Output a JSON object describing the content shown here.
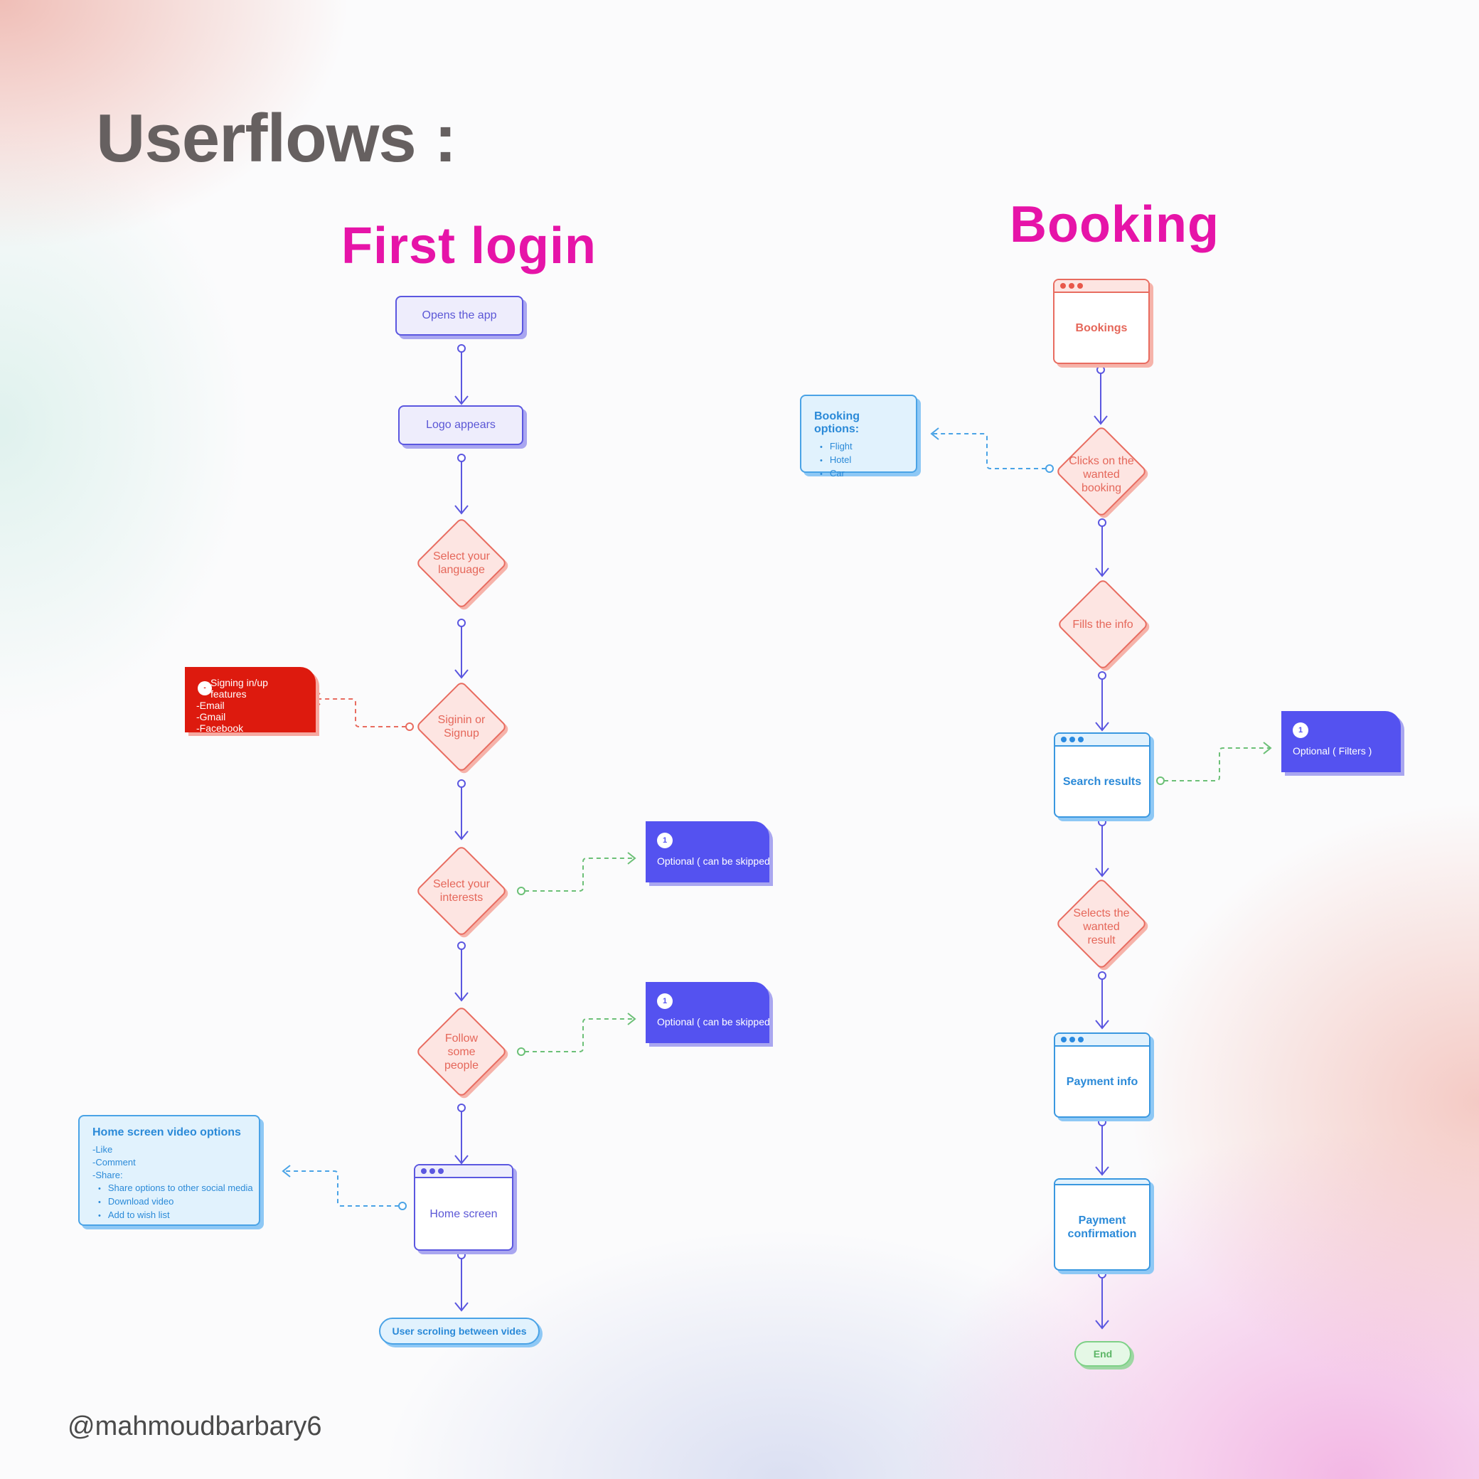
{
  "page": {
    "title": "Userflows :",
    "handle": "@mahmoudbarbary6"
  },
  "first_login": {
    "title": "First login",
    "steps": [
      {
        "id": "opens-app",
        "type": "process",
        "label": "Opens the app"
      },
      {
        "id": "logo-appears",
        "type": "process",
        "label": "Logo appears"
      },
      {
        "id": "select-language",
        "type": "decision",
        "label": "Select your language"
      },
      {
        "id": "signin-signup",
        "type": "decision",
        "label": "Siginin or Signup"
      },
      {
        "id": "select-interests",
        "type": "decision",
        "label": "Select your interests"
      },
      {
        "id": "follow-people",
        "type": "decision",
        "label": "Follow some people"
      },
      {
        "id": "home-screen",
        "type": "screen",
        "label": "Home screen"
      },
      {
        "id": "user-scrolling",
        "type": "terminal",
        "label": "User scroling between vides"
      }
    ],
    "notes": {
      "signin_callout": {
        "number": "-",
        "lines": [
          "Signing in/up",
          "features",
          "-Email",
          "-Gmail",
          "-Facebook"
        ]
      },
      "interests_callout": {
        "number": "1",
        "text": "Optional ( can be skipped"
      },
      "follow_callout": {
        "number": "1",
        "text": "Optional ( can be skipped"
      },
      "home_options": {
        "title": "Home screen video options",
        "items": [
          "-Like",
          "-Comment",
          "-Share:"
        ],
        "bullets": [
          "Share options to other social media",
          "Download video",
          "Add to wish list"
        ]
      }
    }
  },
  "booking": {
    "title": "Booking",
    "steps": [
      {
        "id": "bookings",
        "type": "screen",
        "label": "Bookings"
      },
      {
        "id": "clicks-booking",
        "type": "decision",
        "label": "Clicks on the wanted booking"
      },
      {
        "id": "fills-info",
        "type": "decision",
        "label": "Fills the info"
      },
      {
        "id": "search-results",
        "type": "screen",
        "label": "Search results"
      },
      {
        "id": "selects-result",
        "type": "decision",
        "label": "Selects the wanted result"
      },
      {
        "id": "payment-info",
        "type": "screen",
        "label": "Payment info"
      },
      {
        "id": "payment-confirmation",
        "type": "screen",
        "label": "Payment confirmation"
      },
      {
        "id": "end",
        "type": "terminal",
        "label": "End"
      }
    ],
    "notes": {
      "booking_options": {
        "title": "Booking options:",
        "bullets": [
          "Flight",
          "Hotel",
          "Car"
        ]
      },
      "filters_callout": {
        "number": "1",
        "text": "Optional ( Filters )"
      }
    }
  },
  "colors": {
    "title_gray": "#666060",
    "section_magenta": "#e614a8",
    "flow_purple": "#5b57e0",
    "decision_red": "#e86c60",
    "note_blue": "#4aa3e6",
    "optional_green": "#6cc077",
    "callout_purple": "#5452f0",
    "callout_red": "#dd1a0e"
  }
}
